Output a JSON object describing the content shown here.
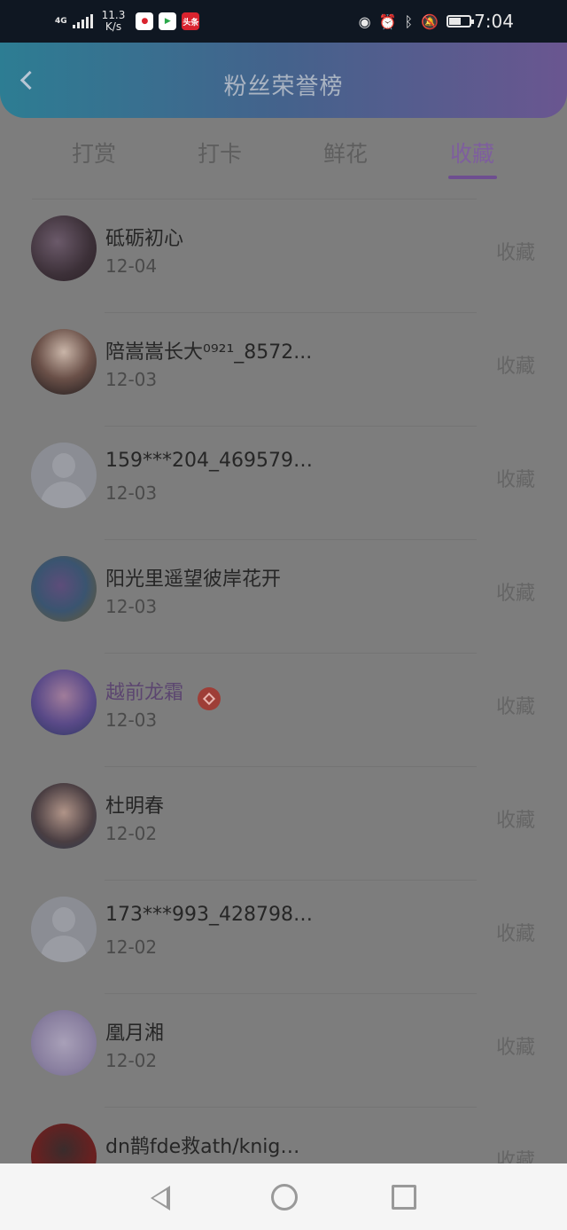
{
  "status_bar": {
    "network": "4G",
    "speed_value": "11.3",
    "speed_unit": "K/s",
    "time": "7:04",
    "apps": [
      {
        "icon": "app-red-icon",
        "label": ""
      },
      {
        "icon": "video-app-icon",
        "label": ""
      },
      {
        "icon": "toutiao-app-icon",
        "label": "头条"
      }
    ],
    "battery_level": 0.55
  },
  "header": {
    "title": "粉丝荣誉榜"
  },
  "tabs": [
    {
      "label": "打赏"
    },
    {
      "label": "打卡"
    },
    {
      "label": "鲜花"
    },
    {
      "label": "收藏"
    }
  ],
  "active_tab": "收藏",
  "list": [
    {
      "name": "砥砺初心",
      "date": "12-04",
      "action": "收藏",
      "avatar": "photo"
    },
    {
      "name": "陪嵩嵩长大⁰⁹²¹_8572...",
      "date": "12-03",
      "action": "收藏",
      "avatar": "photo"
    },
    {
      "name": "159***204_4695791...",
      "date": "12-03",
      "action": "收藏",
      "avatar": "default"
    },
    {
      "name": "阳光里遥望彼岸花开",
      "date": "12-03",
      "action": "收藏",
      "avatar": "photo"
    },
    {
      "name": "越前龙霜",
      "date": "12-03",
      "action": "收藏",
      "avatar": "photo",
      "badge": "vip-badge-icon"
    },
    {
      "name": "杜明春",
      "date": "12-02",
      "action": "收藏",
      "avatar": "photo"
    },
    {
      "name": "173***993_4287989...",
      "date": "12-02",
      "action": "收藏",
      "avatar": "default"
    },
    {
      "name": "凰月湘",
      "date": "12-02",
      "action": "收藏",
      "avatar": "photo"
    },
    {
      "name": "dn鹊fde救ath/knig诲...",
      "date": "",
      "action": "收藏",
      "avatar": "photo"
    }
  ],
  "colors": {
    "header_gradient_start": "#2d7d93",
    "header_gradient_end": "#6a5690",
    "active_tab": "#7e5e9e",
    "badge": "#9e3e37"
  }
}
